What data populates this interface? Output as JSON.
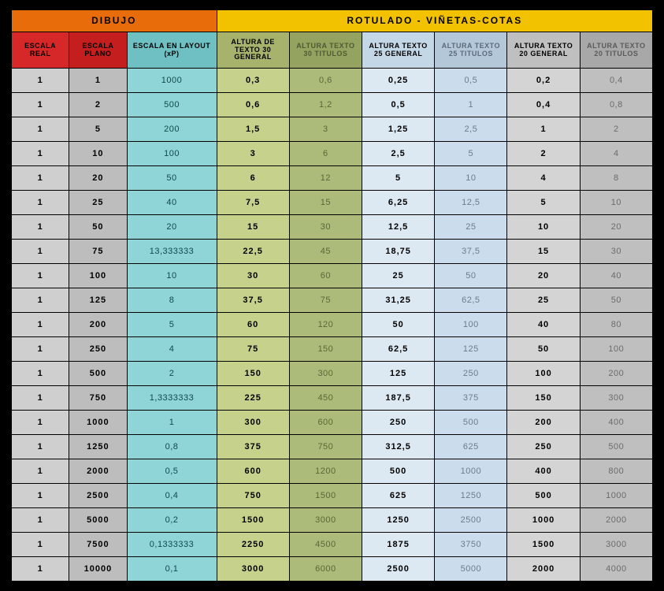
{
  "super_headers": {
    "dibujo": "DIBUJO",
    "rotulado": "ROTULADO - VIÑETAS-COTAS"
  },
  "columns": [
    "ESCALA REAL",
    "ESCALA PLANO",
    "ESCALA EN LAYOUT (xP)",
    "ALTURA DE TEXTO 30 GENERAL",
    "ALTURA TEXTO 30 TITULOS",
    "ALTURA TEXTO 25 GENERAL",
    "ALTURA TEXTO 25 TITULOS",
    "ALTURA TEXTO 20 GENERAL",
    "ALTURA TEXTO 20 TITULOS"
  ],
  "rows": [
    {
      "real": "1",
      "plano": "1",
      "layout": "1000",
      "t30g": "0,3",
      "t30t": "0,6",
      "t25g": "0,25",
      "t25t": "0,5",
      "t20g": "0,2",
      "t20t": "0,4"
    },
    {
      "real": "1",
      "plano": "2",
      "layout": "500",
      "t30g": "0,6",
      "t30t": "1,2",
      "t25g": "0,5",
      "t25t": "1",
      "t20g": "0,4",
      "t20t": "0,8"
    },
    {
      "real": "1",
      "plano": "5",
      "layout": "200",
      "t30g": "1,5",
      "t30t": "3",
      "t25g": "1,25",
      "t25t": "2,5",
      "t20g": "1",
      "t20t": "2"
    },
    {
      "real": "1",
      "plano": "10",
      "layout": "100",
      "t30g": "3",
      "t30t": "6",
      "t25g": "2,5",
      "t25t": "5",
      "t20g": "2",
      "t20t": "4"
    },
    {
      "real": "1",
      "plano": "20",
      "layout": "50",
      "t30g": "6",
      "t30t": "12",
      "t25g": "5",
      "t25t": "10",
      "t20g": "4",
      "t20t": "8"
    },
    {
      "real": "1",
      "plano": "25",
      "layout": "40",
      "t30g": "7,5",
      "t30t": "15",
      "t25g": "6,25",
      "t25t": "12,5",
      "t20g": "5",
      "t20t": "10"
    },
    {
      "real": "1",
      "plano": "50",
      "layout": "20",
      "t30g": "15",
      "t30t": "30",
      "t25g": "12,5",
      "t25t": "25",
      "t20g": "10",
      "t20t": "20"
    },
    {
      "real": "1",
      "plano": "75",
      "layout": "13,333333",
      "t30g": "22,5",
      "t30t": "45",
      "t25g": "18,75",
      "t25t": "37,5",
      "t20g": "15",
      "t20t": "30"
    },
    {
      "real": "1",
      "plano": "100",
      "layout": "10",
      "t30g": "30",
      "t30t": "60",
      "t25g": "25",
      "t25t": "50",
      "t20g": "20",
      "t20t": "40"
    },
    {
      "real": "1",
      "plano": "125",
      "layout": "8",
      "t30g": "37,5",
      "t30t": "75",
      "t25g": "31,25",
      "t25t": "62,5",
      "t20g": "25",
      "t20t": "50"
    },
    {
      "real": "1",
      "plano": "200",
      "layout": "5",
      "t30g": "60",
      "t30t": "120",
      "t25g": "50",
      "t25t": "100",
      "t20g": "40",
      "t20t": "80"
    },
    {
      "real": "1",
      "plano": "250",
      "layout": "4",
      "t30g": "75",
      "t30t": "150",
      "t25g": "62,5",
      "t25t": "125",
      "t20g": "50",
      "t20t": "100"
    },
    {
      "real": "1",
      "plano": "500",
      "layout": "2",
      "t30g": "150",
      "t30t": "300",
      "t25g": "125",
      "t25t": "250",
      "t20g": "100",
      "t20t": "200"
    },
    {
      "real": "1",
      "plano": "750",
      "layout": "1,3333333",
      "t30g": "225",
      "t30t": "450",
      "t25g": "187,5",
      "t25t": "375",
      "t20g": "150",
      "t20t": "300"
    },
    {
      "real": "1",
      "plano": "1000",
      "layout": "1",
      "t30g": "300",
      "t30t": "600",
      "t25g": "250",
      "t25t": "500",
      "t20g": "200",
      "t20t": "400"
    },
    {
      "real": "1",
      "plano": "1250",
      "layout": "0,8",
      "t30g": "375",
      "t30t": "750",
      "t25g": "312,5",
      "t25t": "625",
      "t20g": "250",
      "t20t": "500"
    },
    {
      "real": "1",
      "plano": "2000",
      "layout": "0,5",
      "t30g": "600",
      "t30t": "1200",
      "t25g": "500",
      "t25t": "1000",
      "t20g": "400",
      "t20t": "800"
    },
    {
      "real": "1",
      "plano": "2500",
      "layout": "0,4",
      "t30g": "750",
      "t30t": "1500",
      "t25g": "625",
      "t25t": "1250",
      "t20g": "500",
      "t20t": "1000"
    },
    {
      "real": "1",
      "plano": "5000",
      "layout": "0,2",
      "t30g": "1500",
      "t30t": "3000",
      "t25g": "1250",
      "t25t": "2500",
      "t20g": "1000",
      "t20t": "2000"
    },
    {
      "real": "1",
      "plano": "7500",
      "layout": "0,1333333",
      "t30g": "2250",
      "t30t": "4500",
      "t25g": "1875",
      "t25t": "3750",
      "t20g": "1500",
      "t20t": "3000"
    },
    {
      "real": "1",
      "plano": "10000",
      "layout": "0,1",
      "t30g": "3000",
      "t30t": "6000",
      "t25g": "2500",
      "t25t": "5000",
      "t20g": "2000",
      "t20t": "4000"
    }
  ]
}
